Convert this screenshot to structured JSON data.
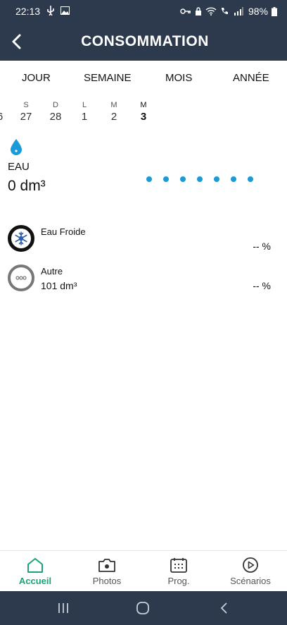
{
  "status_bar": {
    "time": "22:13",
    "battery": "98%"
  },
  "app_bar": {
    "title": "CONSOMMATION",
    "back_icon": "chevron-left-icon"
  },
  "period_tabs": [
    {
      "label": "JOUR"
    },
    {
      "label": "SEMAINE"
    },
    {
      "label": "MOIS"
    },
    {
      "label": "ANNÉE"
    }
  ],
  "days": [
    {
      "letter": "",
      "number": "6"
    },
    {
      "letter": "S",
      "number": "27"
    },
    {
      "letter": "D",
      "number": "28"
    },
    {
      "letter": "L",
      "number": "1"
    },
    {
      "letter": "M",
      "number": "2"
    },
    {
      "letter": "M",
      "number": "3",
      "active": true
    }
  ],
  "water": {
    "label": "EAU",
    "value": "0 dm³",
    "icon": "water-drop-icon",
    "color": "#1a9ad8"
  },
  "breakdown": [
    {
      "name": "Eau Froide",
      "value": "",
      "percent": "-- %",
      "icon": "snowflake-icon"
    },
    {
      "name": "Autre",
      "value": "101 dm³",
      "percent": "-- %",
      "icon": "more-dots-icon"
    }
  ],
  "bottom_nav": [
    {
      "label": "Accueil",
      "icon": "home-icon",
      "active": true
    },
    {
      "label": "Photos",
      "icon": "camera-icon"
    },
    {
      "label": "Prog.",
      "icon": "calendar-icon"
    },
    {
      "label": "Scénarios",
      "icon": "play-circle-icon"
    }
  ],
  "colors": {
    "header": "#2d3a4e",
    "accent": "#1aa37a",
    "water": "#1a9ad8"
  }
}
